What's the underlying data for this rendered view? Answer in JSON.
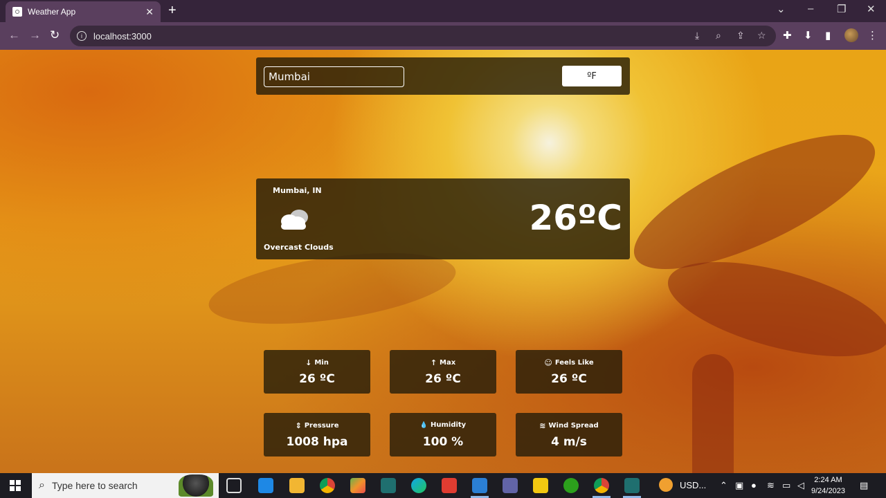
{
  "browser": {
    "tab_title": "Weather App",
    "tab_close": "✕",
    "new_tab": "+",
    "address": "localhost:3000",
    "window_controls": [
      "⌄",
      "–",
      "❐",
      "✕"
    ]
  },
  "app": {
    "search_value": "Mumbai",
    "unit_toggle_label": "ºF",
    "current": {
      "city": "Mumbai, IN",
      "description": "Overcast Clouds",
      "temperature": "26ºC",
      "icon": "cloud-icon"
    },
    "stats": [
      {
        "icon": "arrow-down-icon",
        "glyph": "↓",
        "label": "Min",
        "value": "26 ºC"
      },
      {
        "icon": "arrow-up-icon",
        "glyph": "↑",
        "label": "Max",
        "value": "26 ºC"
      },
      {
        "icon": "smile-icon",
        "glyph": "☺",
        "label": "Feels Like",
        "value": "26 ºC"
      },
      {
        "icon": "pressure-icon",
        "glyph": "⇕",
        "label": "Pressure",
        "value": "1008 hpa"
      },
      {
        "icon": "droplet-icon",
        "glyph": "💧",
        "label": "Humidity",
        "value": "100 %"
      },
      {
        "icon": "wind-icon",
        "glyph": "≋",
        "label": "Wind Spread",
        "value": "4 m/s"
      }
    ]
  },
  "taskbar": {
    "search_placeholder": "Type here to search",
    "tray_text": "USD...",
    "time": "2:24 AM",
    "date": "9/24/2023"
  }
}
